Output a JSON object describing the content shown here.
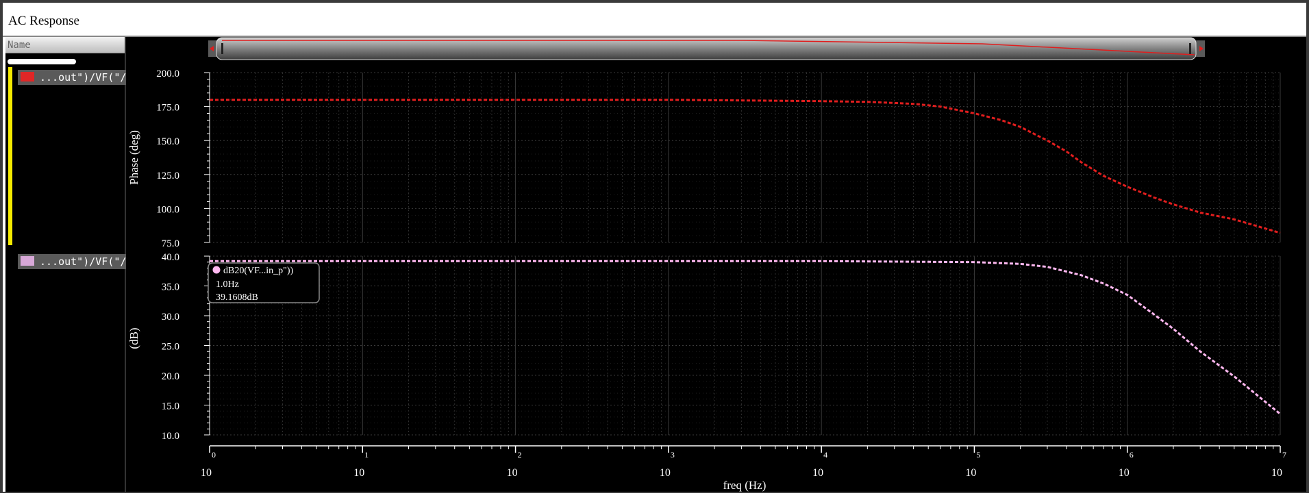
{
  "window": {
    "title": "AC Response"
  },
  "sidebar": {
    "header": "Name",
    "traces": [
      {
        "label": "...out\")/VF(\"/V",
        "color": "#e02626"
      },
      {
        "label": "...out\")/VF(\"/V",
        "color": "#d8a8d8"
      }
    ]
  },
  "colors": {
    "phase_trace": "#e01e1e",
    "db_trace": "#ffb8f0",
    "grid": "#2e2e2e",
    "axis": "#ffffff"
  },
  "chart_data": [
    {
      "type": "line",
      "ylabel": "Phase (deg)",
      "xlabel": "freq (Hz)",
      "xscale": "log",
      "xlim": [
        1,
        10000000
      ],
      "ylim": [
        75.0,
        200.0
      ],
      "yticks": [
        "200.0",
        "175.0",
        "150.0",
        "125.0",
        "100.0",
        "75.0"
      ],
      "series": [
        {
          "x": [
            1,
            10,
            100,
            1000,
            10000,
            20000,
            40000,
            60000,
            100000,
            150000,
            200000,
            300000,
            400000,
            500000,
            700000,
            1000000,
            1500000,
            2000000,
            3000000,
            5000000,
            10000000
          ],
          "y": [
            180,
            180,
            180,
            180,
            179,
            178.5,
            177,
            175,
            170,
            165,
            160,
            150,
            142,
            134,
            124,
            116,
            108,
            103,
            97,
            92,
            82
          ]
        }
      ]
    },
    {
      "type": "line",
      "ylabel": "(dB)",
      "xlabel": "freq (Hz)",
      "xscale": "log",
      "xlim": [
        1,
        10000000
      ],
      "ylim": [
        10.0,
        40.0
      ],
      "yticks": [
        "40.0",
        "35.0",
        "30.0",
        "25.0",
        "20.0",
        "15.0",
        "10.0"
      ],
      "series": [
        {
          "x": [
            1,
            10,
            100,
            1000,
            10000,
            100000,
            200000,
            300000,
            500000,
            700000,
            1000000,
            1500000,
            2000000,
            3000000,
            5000000,
            10000000
          ],
          "y": [
            39.16,
            39.16,
            39.16,
            39.16,
            39.16,
            39.0,
            38.7,
            38.2,
            36.8,
            35.4,
            33.5,
            30.2,
            27.8,
            24.0,
            19.8,
            13.5
          ]
        }
      ],
      "marker": {
        "name": "dB20(VF...in_p\"))",
        "x_label": "1.0Hz",
        "y_label": "39.1608dB"
      }
    }
  ],
  "xaxis": {
    "exponents": [
      "0",
      "1",
      "2",
      "3",
      "4",
      "5",
      "6",
      "7"
    ],
    "base": "10",
    "label": "freq (Hz)"
  }
}
